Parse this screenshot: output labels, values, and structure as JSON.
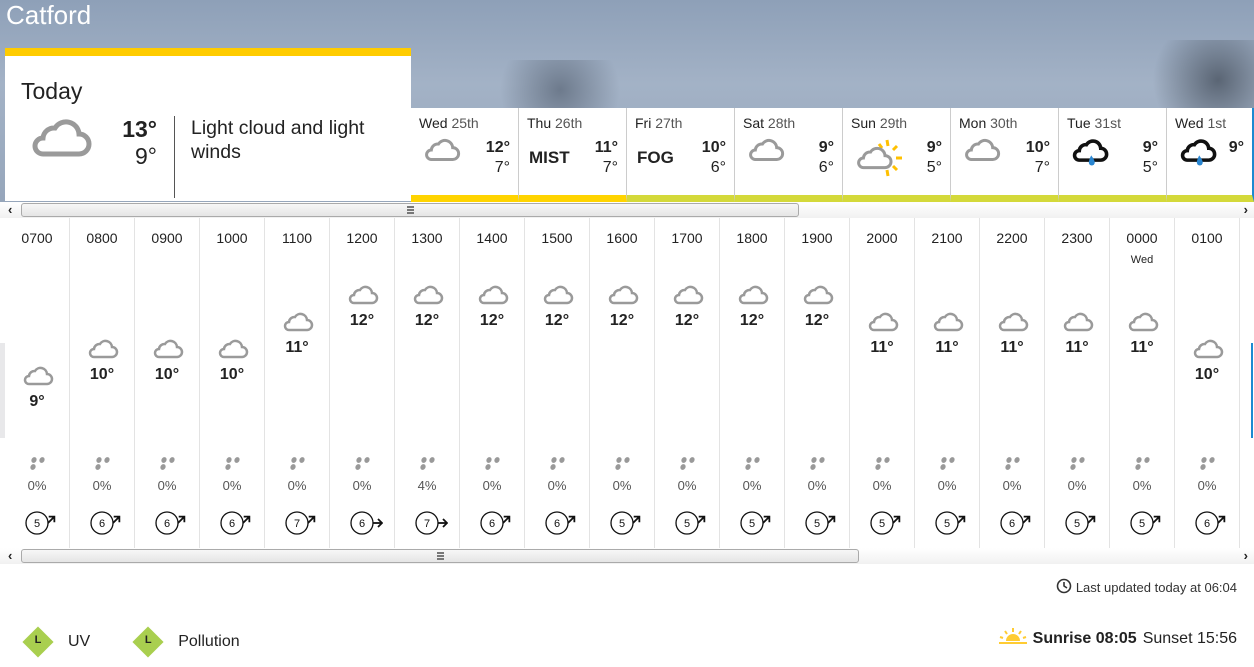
{
  "location": "Catford",
  "today": {
    "label": "Today",
    "icon": "light-cloud-icon",
    "high": "13°",
    "low": "9°",
    "description": "Light cloud and light winds"
  },
  "days": [
    {
      "weekday": "Wed",
      "date": "25th",
      "icon": "light-cloud-icon",
      "text": "",
      "high": "12°",
      "low": "7°",
      "bar_color": "#ffd400"
    },
    {
      "weekday": "Thu",
      "date": "26th",
      "icon": "",
      "text": "MIST",
      "high": "11°",
      "low": "7°",
      "bar_color": "#ffd400"
    },
    {
      "weekday": "Fri",
      "date": "27th",
      "icon": "",
      "text": "FOG",
      "high": "10°",
      "low": "6°",
      "bar_color": "#d4d93a"
    },
    {
      "weekday": "Sat",
      "date": "28th",
      "icon": "light-cloud-icon",
      "text": "",
      "high": "9°",
      "low": "6°",
      "bar_color": "#d4d93a"
    },
    {
      "weekday": "Sun",
      "date": "29th",
      "icon": "sunny-intervals-icon",
      "text": "",
      "high": "9°",
      "low": "5°",
      "bar_color": "#d4d93a"
    },
    {
      "weekday": "Mon",
      "date": "30th",
      "icon": "light-cloud-icon",
      "text": "",
      "high": "10°",
      "low": "7°",
      "bar_color": "#d4d93a"
    },
    {
      "weekday": "Tue",
      "date": "31st",
      "icon": "light-rain-icon",
      "text": "",
      "high": "9°",
      "low": "5°",
      "bar_color": "#d4d93a"
    },
    {
      "weekday": "Wed",
      "date": "1st",
      "icon": "light-rain-icon",
      "text": "",
      "high": "9°",
      "low": "",
      "bar_color": "#d4d93a"
    }
  ],
  "hours": [
    {
      "time": "0700",
      "sub": "",
      "temp": "9°",
      "temp_c": 9,
      "rain": "0%",
      "wind": "5",
      "wind_dir": "ne"
    },
    {
      "time": "0800",
      "sub": "",
      "temp": "10°",
      "temp_c": 10,
      "rain": "0%",
      "wind": "6",
      "wind_dir": "ne"
    },
    {
      "time": "0900",
      "sub": "",
      "temp": "10°",
      "temp_c": 10,
      "rain": "0%",
      "wind": "6",
      "wind_dir": "ne"
    },
    {
      "time": "1000",
      "sub": "",
      "temp": "10°",
      "temp_c": 10,
      "rain": "0%",
      "wind": "6",
      "wind_dir": "ne"
    },
    {
      "time": "1100",
      "sub": "",
      "temp": "11°",
      "temp_c": 11,
      "rain": "0%",
      "wind": "7",
      "wind_dir": "ne"
    },
    {
      "time": "1200",
      "sub": "",
      "temp": "12°",
      "temp_c": 12,
      "rain": "0%",
      "wind": "6",
      "wind_dir": "e"
    },
    {
      "time": "1300",
      "sub": "",
      "temp": "12°",
      "temp_c": 12,
      "rain": "4%",
      "wind": "7",
      "wind_dir": "e"
    },
    {
      "time": "1400",
      "sub": "",
      "temp": "12°",
      "temp_c": 12,
      "rain": "0%",
      "wind": "6",
      "wind_dir": "ne"
    },
    {
      "time": "1500",
      "sub": "",
      "temp": "12°",
      "temp_c": 12,
      "rain": "0%",
      "wind": "6",
      "wind_dir": "ne"
    },
    {
      "time": "1600",
      "sub": "",
      "temp": "12°",
      "temp_c": 12,
      "rain": "0%",
      "wind": "5",
      "wind_dir": "ne"
    },
    {
      "time": "1700",
      "sub": "",
      "temp": "12°",
      "temp_c": 12,
      "rain": "0%",
      "wind": "5",
      "wind_dir": "ne"
    },
    {
      "time": "1800",
      "sub": "",
      "temp": "12°",
      "temp_c": 12,
      "rain": "0%",
      "wind": "5",
      "wind_dir": "ne"
    },
    {
      "time": "1900",
      "sub": "",
      "temp": "12°",
      "temp_c": 12,
      "rain": "0%",
      "wind": "5",
      "wind_dir": "ne"
    },
    {
      "time": "2000",
      "sub": "",
      "temp": "11°",
      "temp_c": 11,
      "rain": "0%",
      "wind": "5",
      "wind_dir": "ne"
    },
    {
      "time": "2100",
      "sub": "",
      "temp": "11°",
      "temp_c": 11,
      "rain": "0%",
      "wind": "5",
      "wind_dir": "ne"
    },
    {
      "time": "2200",
      "sub": "",
      "temp": "11°",
      "temp_c": 11,
      "rain": "0%",
      "wind": "6",
      "wind_dir": "ne"
    },
    {
      "time": "2300",
      "sub": "",
      "temp": "11°",
      "temp_c": 11,
      "rain": "0%",
      "wind": "5",
      "wind_dir": "ne"
    },
    {
      "time": "0000",
      "sub": "Wed",
      "temp": "11°",
      "temp_c": 11,
      "rain": "0%",
      "wind": "5",
      "wind_dir": "ne"
    },
    {
      "time": "0100",
      "sub": "",
      "temp": "10°",
      "temp_c": 10,
      "rain": "0%",
      "wind": "6",
      "wind_dir": "ne"
    }
  ],
  "last_updated": "Last updated today at 06:04",
  "badges": [
    {
      "level": "L",
      "label": "UV"
    },
    {
      "level": "L",
      "label": "Pollution"
    }
  ],
  "sun": {
    "sunrise_label": "Sunrise 08:05",
    "sunset_label": "Sunset 15:56"
  },
  "scroll": {
    "left": "‹",
    "right": "›"
  }
}
